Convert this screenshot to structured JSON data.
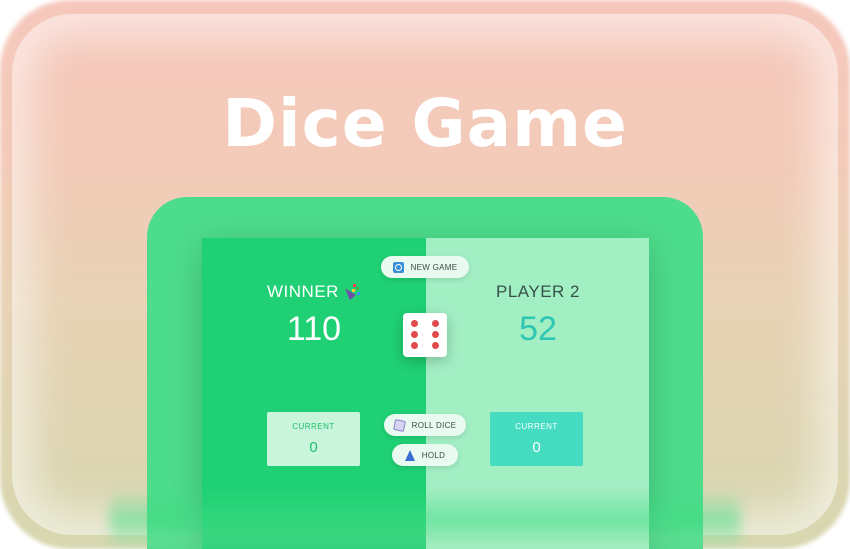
{
  "app": {
    "title": "Dice Game"
  },
  "players": [
    {
      "name": "WINNER",
      "score": "110",
      "current_label": "CURRENT",
      "current": "0",
      "winner": true
    },
    {
      "name": "PLAYER 2",
      "score": "52",
      "current_label": "CURRENT",
      "current": "0",
      "winner": false
    }
  ],
  "controls": {
    "new_game": "NEW GAME",
    "roll_dice": "ROLL DICE",
    "hold": "HOLD"
  },
  "dice": {
    "value": 6
  },
  "icons": {
    "new_game": "refresh-icon",
    "roll_dice": "dice-icon",
    "hold": "hold-icon",
    "winner": "party-popper-icon"
  },
  "colors": {
    "active_panel": "#1fd174",
    "inactive_panel": "#a3efc4",
    "frame": "#4ddc8b",
    "score_p2": "#2ec7b4",
    "dice_pip": "#e24b4b"
  }
}
